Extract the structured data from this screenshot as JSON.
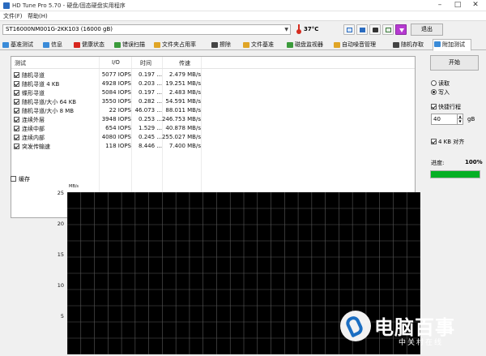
{
  "window": {
    "title": "HD Tune Pro 5.70 - 硬盘/固态硬盘实用程序"
  },
  "menu": [
    "文件(F)",
    "帮助(H)"
  ],
  "toolbar": {
    "drive": "ST16000NM001G-2KK103 (16000 gB)",
    "temperature": "37°C",
    "exit_label": "退出",
    "icons": [
      "copy-icon",
      "save-icon",
      "camera-icon",
      "options-icon",
      "download-icon"
    ]
  },
  "tabs": [
    {
      "label": "基准测试",
      "icon_color": "#3a8bd8"
    },
    {
      "label": "信息",
      "icon_color": "#3a8bd8"
    },
    {
      "label": "健康状态",
      "icon_color": "#d7261e"
    },
    {
      "label": "错误扫描",
      "icon_color": "#3b9b3b"
    },
    {
      "label": "文件夹占用率",
      "icon_color": "#e0a526"
    },
    {
      "label": "擦除",
      "icon_color": "#444444"
    },
    {
      "label": "文件基准",
      "icon_color": "#e0a526"
    },
    {
      "label": "磁盘监视器",
      "icon_color": "#3b9b3b"
    },
    {
      "label": "自动噪音管理",
      "icon_color": "#e0a526"
    },
    {
      "label": "随机存取",
      "icon_color": "#444444"
    },
    {
      "label": "附加测试",
      "icon_color": "#3a8bd8"
    }
  ],
  "active_tab": 10,
  "test_table": {
    "headers": {
      "test": "测试",
      "io": "I/O",
      "time": "时间",
      "rate": "传速"
    },
    "rows": [
      {
        "name": "随机寻道",
        "io": "5077 IOPS",
        "time": "0.197 ...",
        "rate": "2.479 MB/s"
      },
      {
        "name": "随机寻道 4 KB",
        "io": "4928 IOPS",
        "time": "0.203 ...",
        "rate": "19.251 MB/s"
      },
      {
        "name": "蝶形寻道",
        "io": "5084 IOPS",
        "time": "0.197 ...",
        "rate": "2.483 MB/s"
      },
      {
        "name": "随机寻道/大小 64 KB",
        "io": "3550 IOPS",
        "time": "0.282 ...",
        "rate": "54.591 MB/s"
      },
      {
        "name": "随机寻道/大小 8 MB",
        "io": "22 IOPS",
        "time": "46.073 ...",
        "rate": "88.011 MB/s"
      },
      {
        "name": "连续外层",
        "io": "3948 IOPS",
        "time": "0.253 ...",
        "rate": "246.753 MB/s"
      },
      {
        "name": "连续中部",
        "io": "654 IOPS",
        "time": "1.529 ...",
        "rate": "40.878 MB/s"
      },
      {
        "name": "连续内部",
        "io": "4080 IOPS",
        "time": "0.245 ...",
        "rate": "255.027 MB/s"
      },
      {
        "name": "突发传输速",
        "io": "118 IOPS",
        "time": "8.446 ...",
        "rate": "7.400 MB/s"
      }
    ]
  },
  "queue_label": "缓存",
  "side": {
    "start_label": "开始",
    "read_label": "读取",
    "write_label": "写入",
    "selected_mode": "write",
    "quick_label": "快捷行程",
    "quick_value": "40",
    "quick_unit": "gB",
    "align_label": "4 KB 对齐",
    "progress_label": "进度:",
    "progress_text": "100%",
    "progress_value": 1.0
  },
  "chart_data": {
    "type": "line",
    "ylabel": "MB/s",
    "ylim": [
      0,
      25
    ],
    "yticks": [
      25,
      20,
      15,
      10,
      5
    ],
    "series": [],
    "grid": true
  },
  "watermark": {
    "name": "电脑百事",
    "sub": "中关村在线"
  },
  "colors": {
    "progress": "#06b025",
    "chart_bg": "#000000",
    "grid": "#5a5a5a"
  }
}
